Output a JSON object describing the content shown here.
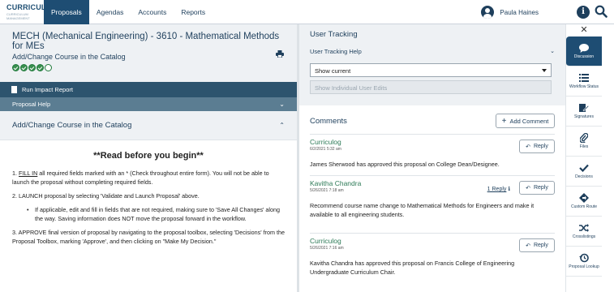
{
  "app": {
    "logo_main": "CURRICULOG",
    "logo_sub": "CURRICULUM MANAGEMENT"
  },
  "nav": [
    "Proposals",
    "Agendas",
    "Accounts",
    "Reports"
  ],
  "user": {
    "name": "Paula Haines"
  },
  "proposal": {
    "title": "MECH (Mechanical Engineering) - 3610 - Mathematical Methods for MEs",
    "subtitle": "Add/Change Course in the Catalog",
    "progress": {
      "completed": 4,
      "total": 5
    }
  },
  "left": {
    "run_impact": "Run Impact Report",
    "proposal_help": "Proposal Help",
    "section_title": "Add/Change Course in the Catalog",
    "read_heading": "**Read before you begin**",
    "step1_a": "1. ",
    "step1_link": "FILL IN",
    "step1_b": " all required fields marked with an * (Check throughout entire form). You will not be able to launch the proposal without completing required fields.",
    "step2": "2. LAUNCH proposal by selecting 'Validate and Launch Proposal' above.",
    "step2_bullet": "If applicable, edit and fill in fields that are not required, making sure to 'Save All Changes' along the way. Saving information does NOT move the proposal forward in the workflow.",
    "step3": "3. APPROVE final version of proposal by navigating to the proposal toolbox, selecting 'Decisions' from the Proposal Toolbox, marking 'Approve', and then clicking on \"Make My Decision.\""
  },
  "tracking": {
    "title": "User Tracking",
    "help": "User Tracking Help",
    "select_value": "Show current",
    "disabled_value": "Show Individual User Edits"
  },
  "comments": {
    "title": "Comments",
    "add_label": "Add Comment",
    "reply_label": "Reply",
    "items": [
      {
        "name": "Curriculog",
        "time": "6/2/2021 5:32 am",
        "text": "James Sherwood has approved this proposal on College Dean/Designee.",
        "reply_count": ""
      },
      {
        "name": "Kavitha Chandra",
        "time": "5/26/2021 7:18 am",
        "text": "Recommend course name change to Mathematical Methods for Engineers and make it available to all engineering students.",
        "reply_count": "1 Reply"
      },
      {
        "name": "Curriculog",
        "time": "5/26/2021 7:16 am",
        "text": "Kavitha Chandra has approved this proposal on Francis College of Engineering Undergraduate Curriculum Chair.",
        "reply_count": ""
      }
    ]
  },
  "toolbox": [
    {
      "label": "Discussion",
      "icon": "chat-icon",
      "active": true
    },
    {
      "label": "Workflow Status",
      "icon": "list-icon",
      "active": false
    },
    {
      "label": "Signatures",
      "icon": "signature-icon",
      "active": false
    },
    {
      "label": "Files",
      "icon": "paperclip-icon",
      "active": false
    },
    {
      "label": "Decisions",
      "icon": "check-icon",
      "active": false
    },
    {
      "label": "Custom Route",
      "icon": "route-icon",
      "active": false
    },
    {
      "label": "Crosslistings",
      "icon": "shuffle-icon",
      "active": false
    },
    {
      "label": "Proposal Lookup",
      "icon": "history-icon",
      "active": false
    }
  ],
  "colors": {
    "brand": "#1e4d73",
    "accent_green": "#2d7a57",
    "run_bar": "#2d546e",
    "help_bar": "#5b7d92"
  }
}
